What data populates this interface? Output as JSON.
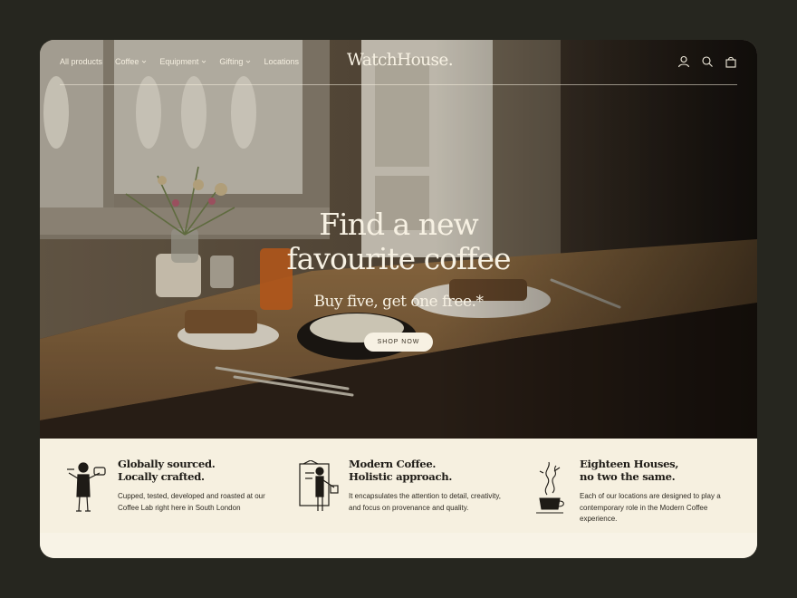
{
  "brand": {
    "logo": "WatchHouse."
  },
  "nav": {
    "links": [
      {
        "label": "All products",
        "dropdown": false
      },
      {
        "label": "Coffee",
        "dropdown": true
      },
      {
        "label": "Equipment",
        "dropdown": true
      },
      {
        "label": "Gifting",
        "dropdown": true
      },
      {
        "label": "Locations",
        "dropdown": false
      }
    ],
    "icons": [
      "account-icon",
      "search-icon",
      "bag-icon"
    ]
  },
  "hero": {
    "title_line1": "Find a new",
    "title_line2": "favourite coffee",
    "subtitle": "Buy five, get one free.*",
    "cta": "SHOP NOW"
  },
  "features": [
    {
      "title_line1": "Globally sourced.",
      "title_line2": "Locally crafted.",
      "body": "Cupped, tested, developed and roasted at our Coffee Lab right here in South London",
      "icon": "barista-illustration-icon"
    },
    {
      "title_line1": "Modern Coffee.",
      "title_line2": "Holistic approach.",
      "body": "It encapsulates the attention to detail, creativity, and focus on provenance and quality.",
      "icon": "coffee-bag-illustration-icon"
    },
    {
      "title_line1": "Eighteen Houses,",
      "title_line2": "no two the same.",
      "body": "Each of our locations are designed to play a contemporary role in the Modern Coffee experience.",
      "icon": "steaming-cup-illustration-icon"
    }
  ],
  "colors": {
    "page_bg": "#26261f",
    "cream": "#f6f0e0",
    "text_dark": "#1e1b16",
    "hero_text": "#f7f1e3"
  }
}
